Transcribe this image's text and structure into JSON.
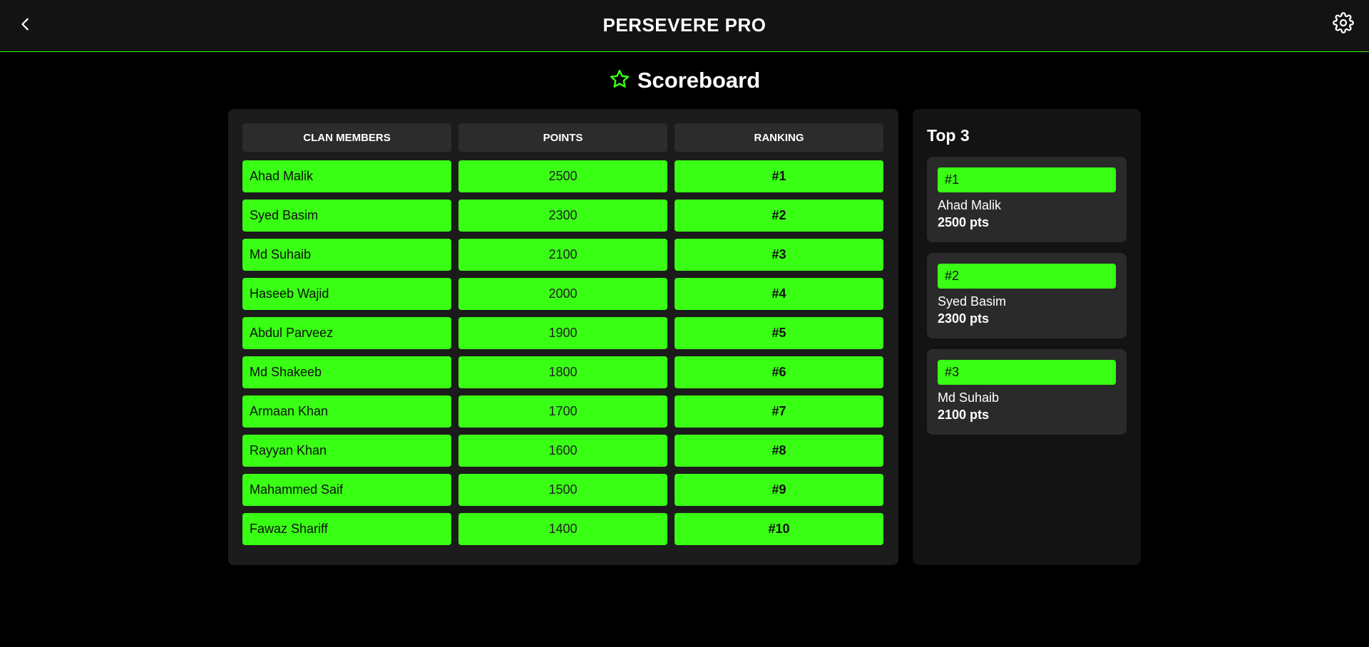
{
  "header": {
    "title": "PERSEVERE PRO",
    "back_icon": "chevron-left-icon",
    "settings_icon": "gear-icon"
  },
  "page": {
    "heading": "Scoreboard",
    "heading_icon": "star-icon"
  },
  "colors": {
    "accent": "#39ff14",
    "background": "#000000",
    "topbar": "#131313",
    "panel": "#1b1b1b"
  },
  "table": {
    "columns": [
      "CLAN MEMBERS",
      "POINTS",
      "RANKING"
    ],
    "rows": [
      {
        "name": "Ahad Malik",
        "points": "2500",
        "rank": "#1"
      },
      {
        "name": "Syed Basim",
        "points": "2300",
        "rank": "#2"
      },
      {
        "name": "Md Suhaib",
        "points": "2100",
        "rank": "#3"
      },
      {
        "name": "Haseeb Wajid",
        "points": "2000",
        "rank": "#4"
      },
      {
        "name": "Abdul Parveez",
        "points": "1900",
        "rank": "#5"
      },
      {
        "name": "Md Shakeeb",
        "points": "1800",
        "rank": "#6"
      },
      {
        "name": "Armaan Khan",
        "points": "1700",
        "rank": "#7"
      },
      {
        "name": "Rayyan Khan",
        "points": "1600",
        "rank": "#8"
      },
      {
        "name": "Mahammed Saif",
        "points": "1500",
        "rank": "#9"
      },
      {
        "name": "Fawaz Shariff",
        "points": "1400",
        "rank": "#10"
      }
    ]
  },
  "top3": {
    "title": "Top 3",
    "cards": [
      {
        "rank": "#1",
        "name": "Ahad Malik",
        "points": "2500 pts"
      },
      {
        "rank": "#2",
        "name": "Syed Basim",
        "points": "2300 pts"
      },
      {
        "rank": "#3",
        "name": "Md Suhaib",
        "points": "2100 pts"
      }
    ]
  }
}
